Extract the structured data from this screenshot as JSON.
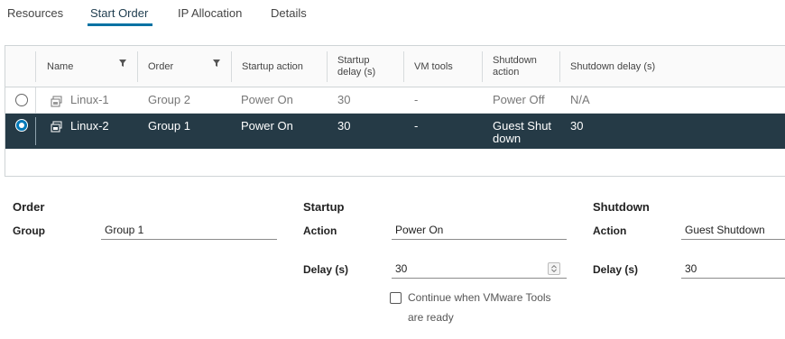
{
  "tabs": [
    {
      "label": "Resources",
      "active": false
    },
    {
      "label": "Start Order",
      "active": true
    },
    {
      "label": "IP Allocation",
      "active": false
    },
    {
      "label": "Details",
      "active": false
    }
  ],
  "table": {
    "headers": {
      "name": "Name",
      "order": "Order",
      "startup_action": "Startup action",
      "startup_delay": "Startup delay (s)",
      "vm_tools": "VM tools",
      "shutdown_action": "Shutdown action",
      "shutdown_delay": "Shutdown delay (s)"
    },
    "rows": [
      {
        "name": "Linux-1",
        "order": "Group 2",
        "startup_action": "Power On",
        "startup_delay": "30",
        "vm_tools": "-",
        "shutdown_action": "Power Off",
        "shutdown_delay": "N/A",
        "selected": false
      },
      {
        "name": "Linux-2",
        "order": "Group 1",
        "startup_action": "Power On",
        "startup_delay": "30",
        "vm_tools": "-",
        "shutdown_action": "Guest Shut down",
        "shutdown_delay": "30",
        "selected": true
      }
    ]
  },
  "form": {
    "order": {
      "title": "Order",
      "group_label": "Group",
      "group_value": "Group 1"
    },
    "startup": {
      "title": "Startup",
      "action_label": "Action",
      "action_value": "Power On",
      "delay_label": "Delay (s)",
      "delay_value": "30",
      "checkbox_label": "Continue when VMware Tools are ready",
      "checkbox_checked": false
    },
    "shutdown": {
      "title": "Shutdown",
      "action_label": "Action",
      "action_value": "Guest Shutdown",
      "delay_label": "Delay (s)",
      "delay_value": "30"
    }
  },
  "colors": {
    "accent": "#0072a3",
    "selected_row": "#253a46",
    "radio_selected": "#0079b8"
  }
}
